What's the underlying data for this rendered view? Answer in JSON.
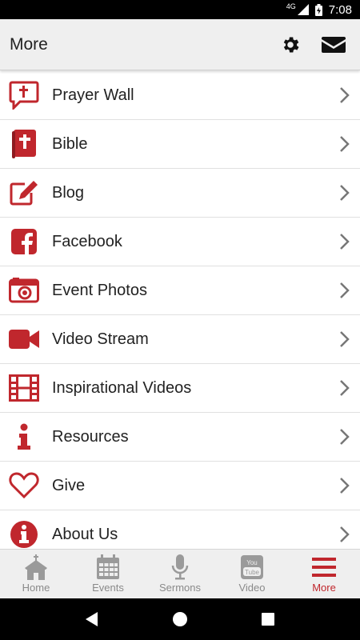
{
  "status_bar": {
    "network": "4G",
    "time": "7:08"
  },
  "app_bar": {
    "title": "More",
    "actions": [
      "gear-icon",
      "mail-icon"
    ]
  },
  "colors": {
    "accent": "#c0272d",
    "inactive": "#8a8a8a",
    "bar_bg": "#efefef"
  },
  "menu": {
    "items": [
      {
        "label": "Prayer Wall",
        "icon": "prayer-chat-icon"
      },
      {
        "label": "Bible",
        "icon": "bible-icon"
      },
      {
        "label": "Blog",
        "icon": "edit-icon"
      },
      {
        "label": "Facebook",
        "icon": "facebook-icon"
      },
      {
        "label": "Event Photos",
        "icon": "camera-icon"
      },
      {
        "label": "Video Stream",
        "icon": "video-camera-icon"
      },
      {
        "label": "Inspirational Videos",
        "icon": "film-icon"
      },
      {
        "label": "Resources",
        "icon": "info-letter-icon"
      },
      {
        "label": "Give",
        "icon": "heart-icon"
      },
      {
        "label": "About Us",
        "icon": "info-circle-icon"
      }
    ]
  },
  "bottom_nav": {
    "tabs": [
      {
        "label": "Home",
        "icon": "church-icon",
        "active": false
      },
      {
        "label": "Events",
        "icon": "calendar-icon",
        "active": false
      },
      {
        "label": "Sermons",
        "icon": "microphone-icon",
        "active": false
      },
      {
        "label": "Video",
        "icon": "youtube-icon",
        "active": false
      },
      {
        "label": "More",
        "icon": "menu-icon",
        "active": true
      }
    ]
  }
}
